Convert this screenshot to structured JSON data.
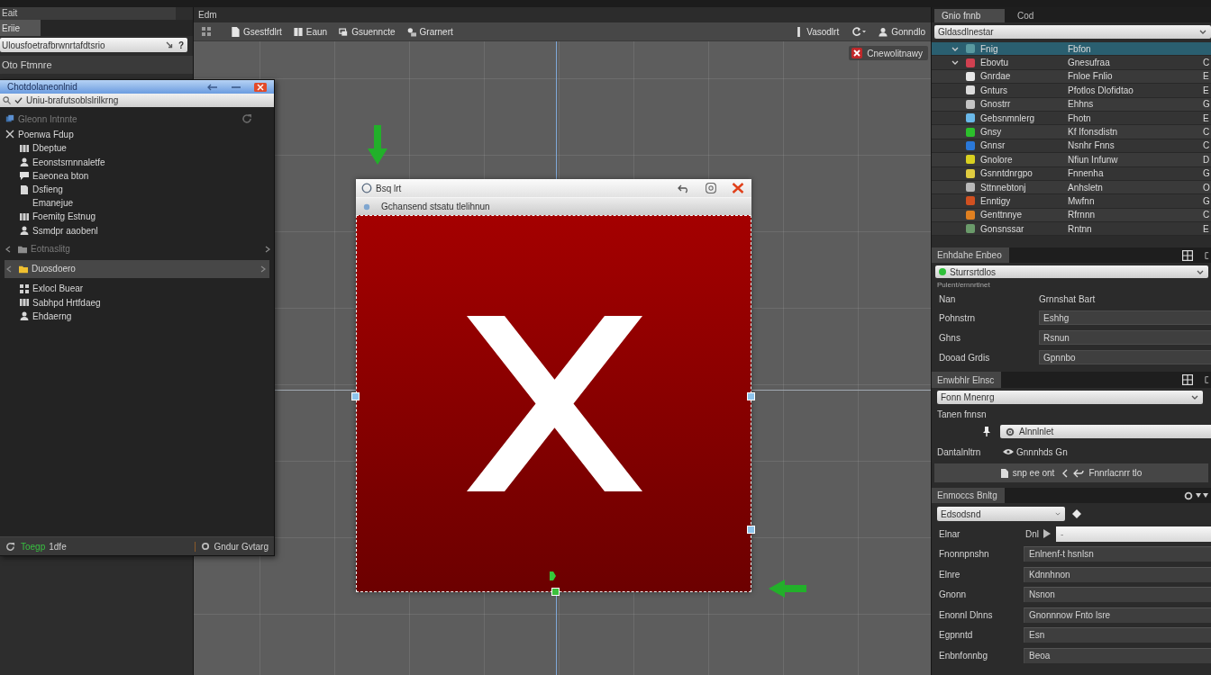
{
  "left_panel": {
    "title": "Eait",
    "tabs": [
      {
        "label": "Eriie",
        "selected": true
      }
    ],
    "search": {
      "value": "Ulousfoetrafbrwnrtafdtsrio",
      "hint_button": "?"
    },
    "section_title": "Oto Ftmnre"
  },
  "floating_panel": {
    "title": "Chotdolaneonlnid",
    "path": "Uniu-brafutsoblslrilkrng",
    "items": [
      {
        "kind": "header",
        "label": "Gleonn Intnnte",
        "selected": false,
        "disabled": true
      },
      {
        "kind": "category",
        "label": "Poenwa Fdup",
        "selected": false,
        "disabled": false,
        "children": [
          {
            "label": "Dbeptue",
            "selected": false
          },
          {
            "label": "Eeonstsrnnnaletfe",
            "selected": false
          },
          {
            "label": "Eaeonea bton",
            "selected": false
          },
          {
            "label": "Dsfieng",
            "selected": false,
            "children": [
              {
                "label": "Emanejue",
                "selected": false
              }
            ]
          },
          {
            "label": "Foemitg Estnug",
            "selected": false
          },
          {
            "label": "Ssmdpr aaobenl",
            "selected": false
          }
        ]
      },
      {
        "kind": "group",
        "label": "Eotnaslitg",
        "selected": false,
        "disabled": true
      },
      {
        "kind": "group",
        "label": "Duosdoero",
        "selected": true,
        "disabled": false,
        "children": [
          {
            "label": "Exlocl Buear",
            "selected": false
          },
          {
            "label": "Sabhpd Hrtfdaeg",
            "selected": false
          },
          {
            "label": "Ehdaerng",
            "selected": false
          }
        ]
      }
    ],
    "status": {
      "accent": "Toegp",
      "text": "1dfe",
      "action": "Gndur Gvtarg"
    }
  },
  "editor": {
    "title": "Edm",
    "toolbar_left": [
      "Gsestfdlrt",
      "Eaun",
      "Gsuenncte",
      "Grarnert"
    ],
    "toolbar_right": [
      "Vasodlrt",
      "Gonndlo"
    ],
    "badge": "Cnewolitnawy",
    "dialog": {
      "title": "Bsq lrt",
      "path": "Gchansend stsatu tlelihnun"
    }
  },
  "right_panel": {
    "tabs": [
      {
        "label": "Gnio fnnb",
        "selected": true
      },
      {
        "label": "Cod",
        "selected": false
      }
    ],
    "filter": {
      "value": "Gldasdlnestar"
    },
    "table": {
      "rows": [
        {
          "kind": "group",
          "name": "Fnig",
          "type": "Fbfon",
          "selected": true,
          "color": "#5a9aa0"
        },
        {
          "kind": "group",
          "name": "Ebovtu",
          "type": "Gnesufraa",
          "column_3": "C",
          "selected": false,
          "color": "#d04050"
        },
        {
          "kind": "item",
          "name": "Gnrdae",
          "type": "Fnloe Fnlio",
          "column_3": "E",
          "selected": false,
          "color": "#e8e8e8"
        },
        {
          "kind": "item",
          "name": "Gnturs",
          "type": "Pfotlos Dlofidtao",
          "column_3": "E",
          "selected": false,
          "color": "#dcdcdc"
        },
        {
          "kind": "item",
          "name": "Gnostrr",
          "type": "Ehhns",
          "column_3": "G",
          "selected": false,
          "color": "#c4c4c4"
        },
        {
          "kind": "item",
          "name": "Gebsnmnlerg",
          "type": "Fhotn",
          "column_3": "E",
          "selected": false,
          "color": "#6ab8e8"
        },
        {
          "kind": "item",
          "name": "Gnsy",
          "type": "Kf Ifonsdistn",
          "column_3": "C",
          "selected": false,
          "color": "#2cc02c"
        },
        {
          "kind": "item",
          "name": "Gnnsr",
          "type": "Nsnhr Fnns",
          "column_3": "C",
          "selected": false,
          "color": "#2a78d8"
        },
        {
          "kind": "item",
          "name": "Gnolore",
          "type": "Nfiun Infunw",
          "column_3": "D",
          "selected": false,
          "color": "#d8d020"
        },
        {
          "kind": "item",
          "name": "Gsnntdnrgpo",
          "type": "Fnnenha",
          "column_3": "G",
          "selected": false,
          "color": "#e0cc40"
        },
        {
          "kind": "item",
          "name": "Sttnnebtonj",
          "type": "Anhsletn",
          "column_3": "O",
          "selected": false,
          "color": "#b8b8b8"
        },
        {
          "kind": "item",
          "name": "Enntigy",
          "type": "Mwfnn",
          "column_3": "G",
          "selected": false,
          "color": "#d05020"
        },
        {
          "kind": "item",
          "name": "Genttnnye",
          "type": "Rfrnnn",
          "column_3": "C",
          "selected": false,
          "color": "#e08020"
        },
        {
          "kind": "item",
          "name": "Gonsnssar",
          "type": "Rntnn",
          "column_3": "E",
          "selected": false,
          "color": "#6a9a6a"
        }
      ]
    },
    "section_a": {
      "title": "Enhdahe Enbeo",
      "preset": "Sturrsrtdlos",
      "caption": "Pulent/ernnrtlnet",
      "rows": [
        {
          "kind": "text",
          "label": "Nan",
          "value": "Grnnshat Bart"
        },
        {
          "kind": "field",
          "label": "Pohnstrn",
          "value": "Eshhg"
        },
        {
          "kind": "field",
          "label": "Ghns",
          "value": "Rsnun"
        },
        {
          "kind": "field",
          "label": "Dooad Grdis",
          "value": "Gpnnbo"
        }
      ]
    },
    "section_b": {
      "title": "Enwbhlr Elnsc",
      "mode": "Fonn Mnenrg",
      "label": "Tanen fnnsn",
      "target": "Alnnlnlet",
      "detail_label": "Dantalnltrn",
      "detail_value": "Gnnnhds Gn",
      "actions": [
        "snp ee ont",
        "Fnnrlacnrr tlo"
      ]
    },
    "section_c": {
      "title": "Enmoccs Bnltg",
      "preset": "Edsodsnd",
      "rows": [
        {
          "kind": "combo",
          "label": "Elnar",
          "unit": "Dnl",
          "placeholder": "-"
        },
        {
          "kind": "field",
          "label": "Fnonnpnshn",
          "value": "Enlnenf-t hsnlsn"
        },
        {
          "kind": "field",
          "label": "Elnre",
          "value": "Kdnnhnon"
        },
        {
          "kind": "field",
          "label": "Gnonn",
          "value": "Nsnon"
        },
        {
          "kind": "field",
          "label": "Enonnl Dlnns",
          "value": "Gnonnnow Fnto lsre"
        },
        {
          "kind": "field",
          "label": "Egpnntd",
          "value": "Esn"
        },
        {
          "kind": "field",
          "label": "Enbnfonnbg",
          "value": "Beoa"
        }
      ]
    }
  }
}
